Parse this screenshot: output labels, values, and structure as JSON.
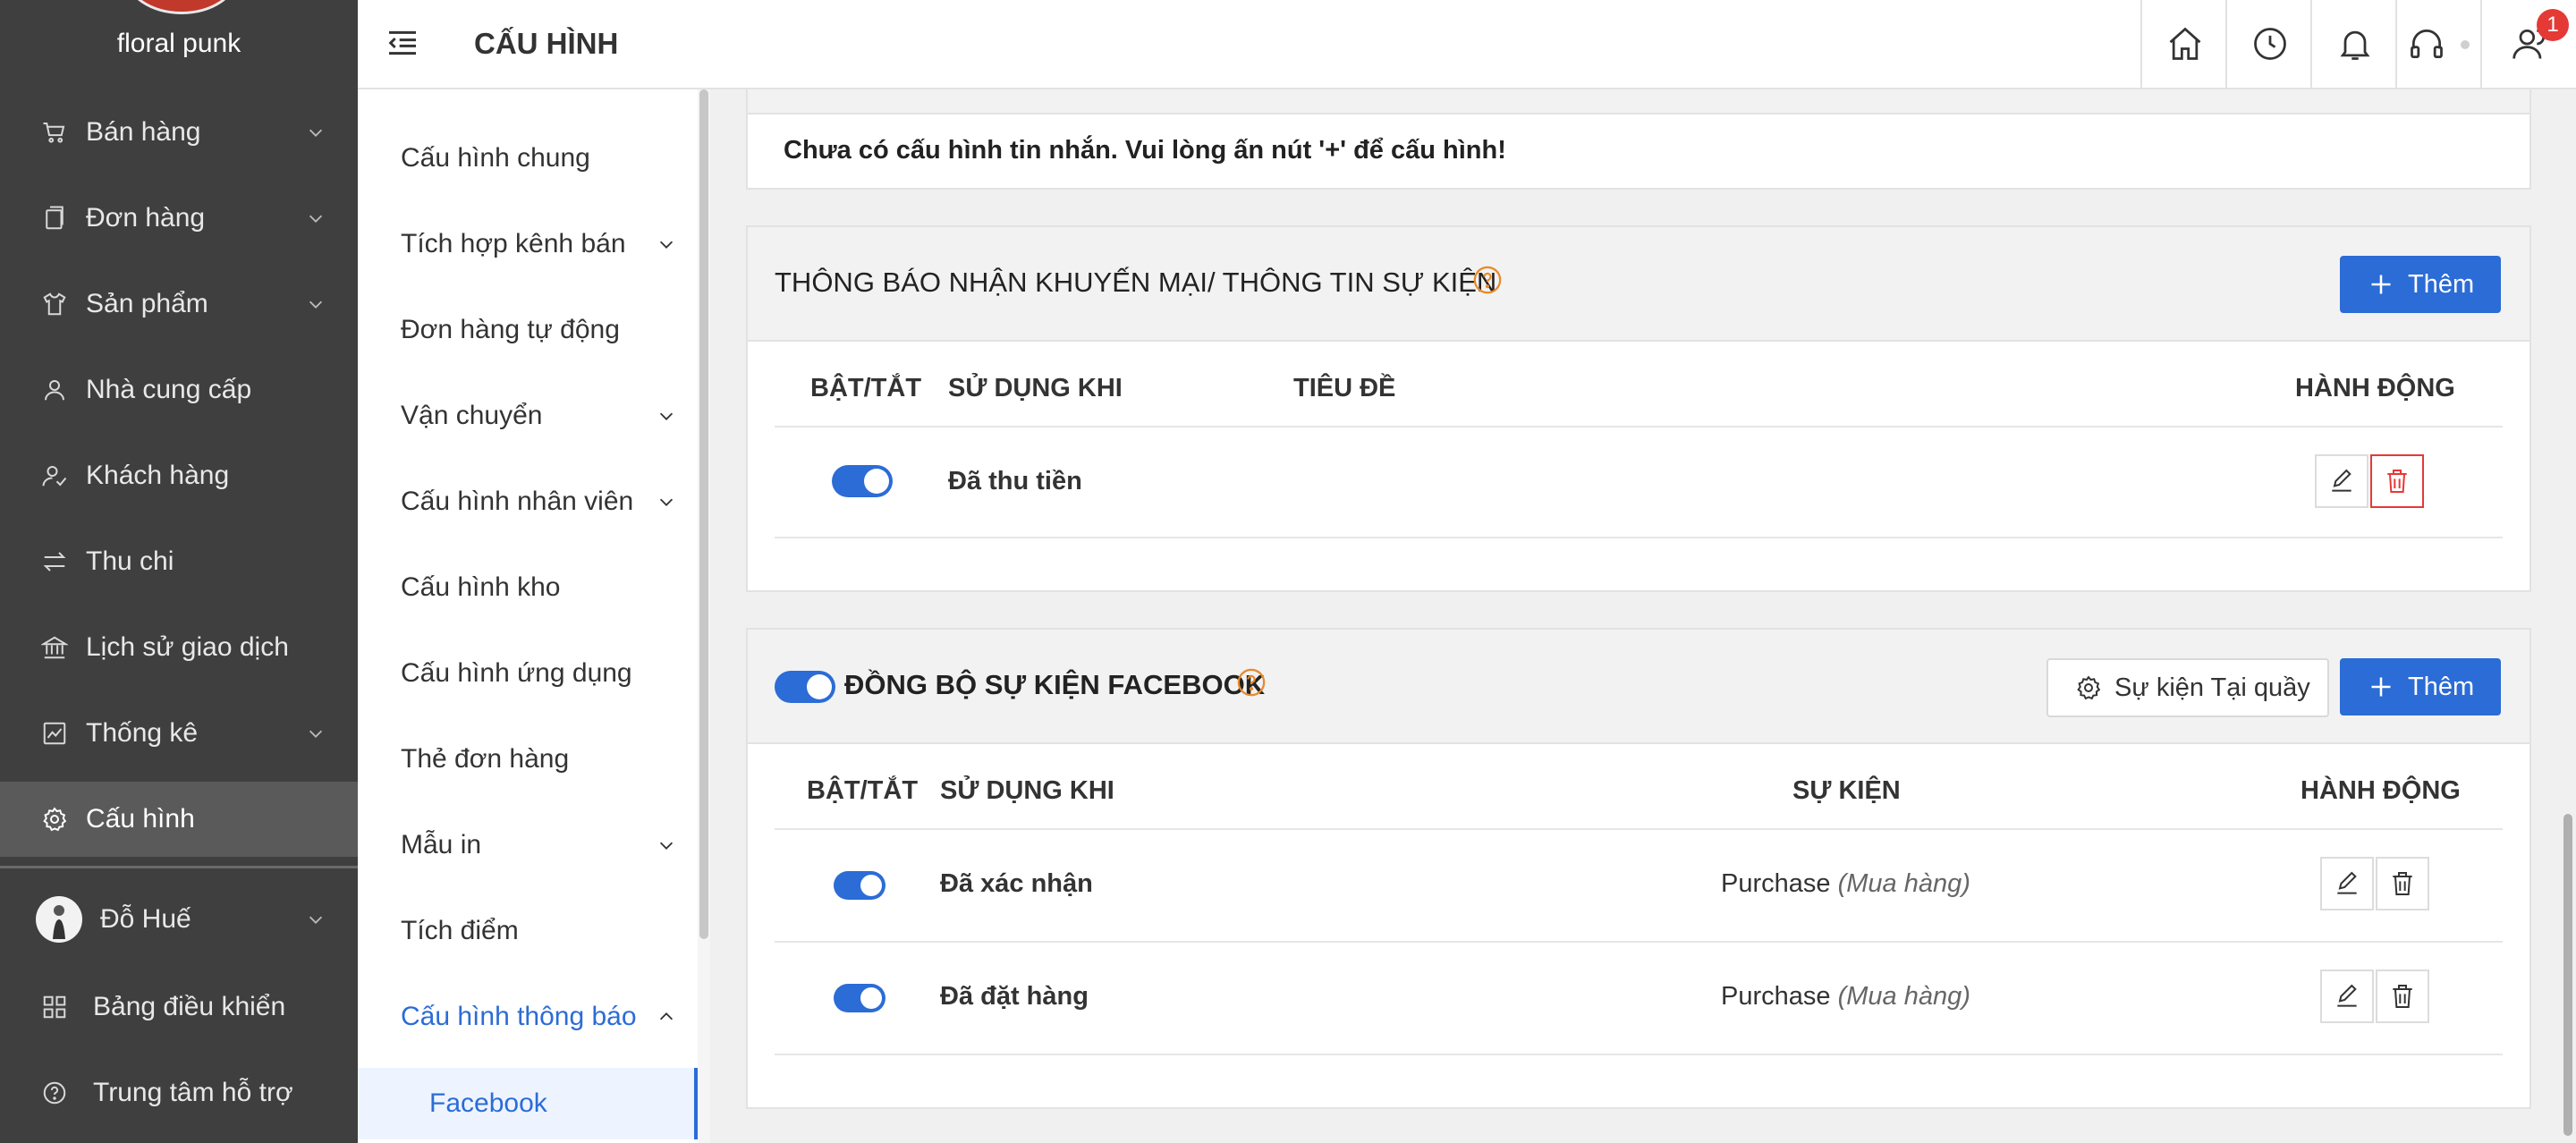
{
  "sidebar": {
    "shop_name": "floral punk",
    "items": [
      {
        "label": "Bán hàng",
        "icon": "cart-icon"
      },
      {
        "label": "Đơn hàng",
        "icon": "orders-icon"
      },
      {
        "label": "Sản phẩm",
        "icon": "shirt-icon"
      },
      {
        "label": "Nhà cung cấp",
        "icon": "supplier-icon"
      },
      {
        "label": "Khách hàng",
        "icon": "customer-icon"
      },
      {
        "label": "Thu chi",
        "icon": "transfer-icon"
      },
      {
        "label": "Lịch sử giao dịch",
        "icon": "bank-icon"
      },
      {
        "label": "Thống kê",
        "icon": "chart-icon"
      },
      {
        "label": "Cấu hình",
        "icon": "gear-icon",
        "active": true
      }
    ],
    "user_name": "Đỗ Huế",
    "bottom_items": [
      {
        "label": "Bảng điều khiển",
        "icon": "dashboard-icon"
      },
      {
        "label": "Trung tâm hỗ trợ",
        "icon": "help-circle-icon"
      }
    ]
  },
  "topbar": {
    "page_title": "CẤU HÌNH",
    "notification_count": "1"
  },
  "submenu": {
    "items": [
      {
        "label": "Cấu hình chung"
      },
      {
        "label": "Tích hợp kênh bán"
      },
      {
        "label": "Đơn hàng tự động"
      },
      {
        "label": "Vận chuyển"
      },
      {
        "label": "Cấu hình nhân viên"
      },
      {
        "label": "Cấu hình kho"
      },
      {
        "label": "Cấu hình ứng dụng"
      },
      {
        "label": "Thẻ đơn hàng"
      },
      {
        "label": "Mẫu in"
      },
      {
        "label": "Tích điểm"
      },
      {
        "label": "Cấu hình thông báo"
      },
      {
        "label": "Facebook"
      }
    ]
  },
  "message_notice": "Chưa có cấu hình tin nhắn. Vui lòng ấn nút '+' để cấu hình!",
  "promo_section": {
    "title": "THÔNG BÁO NHẬN KHUYẾN MẠI/ THÔNG TIN SỰ KIỆN",
    "add_label": "Thêm",
    "columns": [
      "BẬT/TẮT",
      "SỬ DỤNG KHI",
      "TIÊU ĐỀ",
      "HÀNH ĐỘNG"
    ],
    "rows": [
      {
        "enabled": true,
        "use_when": "Đã thu tiền",
        "title": ""
      }
    ]
  },
  "facebook_section": {
    "enabled": true,
    "title": "ĐỒNG BỘ SỰ KIỆN FACEBOOK",
    "counter_events_label": "Sự kiện Tại quầy",
    "add_label": "Thêm",
    "columns": [
      "BẬT/TẮT",
      "SỬ DỤNG KHI",
      "SỰ KIỆN",
      "HÀNH ĐỘNG"
    ],
    "rows": [
      {
        "enabled": true,
        "use_when": "Đã xác nhận",
        "event": "Purchase",
        "event_note": "(Mua hàng)"
      },
      {
        "enabled": true,
        "use_when": "Đã đặt hàng",
        "event": "Purchase",
        "event_note": "(Mua hàng)"
      }
    ]
  },
  "colors": {
    "sidebar_bg": "#3f3f3f",
    "accent": "#2b6cd6",
    "danger": "#e53935",
    "help_icon": "#e8892b"
  }
}
